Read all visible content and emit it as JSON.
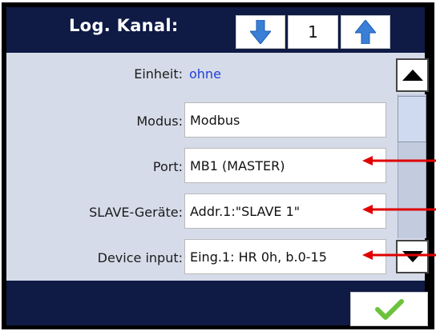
{
  "header": {
    "title": "Log. Kanal:",
    "channel_value": "1"
  },
  "fields": {
    "einheit_label": "Einheit:",
    "einheit_value": "ohne",
    "modus_label": "Modus:",
    "modus_value": "Modbus",
    "port_label": "Port:",
    "port_value": "MB1 (MASTER)",
    "slave_label": "SLAVE-Geräte:",
    "slave_value": "Addr.1:\"SLAVE 1\"",
    "device_label": "Device input:",
    "device_value": "Eing.1: HR 0h, b.0-15"
  },
  "icons": {
    "down": "arrow-down-icon",
    "up": "arrow-up-icon",
    "scroll_up": "triangle-up-icon",
    "scroll_down": "triangle-down-icon",
    "ok": "checkmark-icon",
    "annotation": "red-arrow-icon"
  },
  "colors": {
    "header_bg": "#0f1a45",
    "content_bg": "#d6dbe9",
    "link": "#1f3fd6",
    "arrow_blue": "#3a7fd6",
    "check_green": "#6cc23c",
    "annotation_red": "#e00000"
  }
}
